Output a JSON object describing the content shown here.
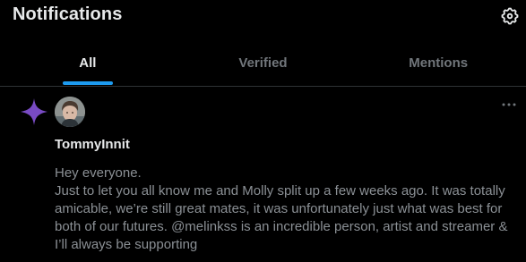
{
  "header": {
    "title": "Notifications",
    "settings_icon": "gear-icon"
  },
  "tabs": [
    {
      "label": "All",
      "active": true
    },
    {
      "label": "Verified",
      "active": false
    },
    {
      "label": "Mentions",
      "active": false
    }
  ],
  "notification": {
    "type_icon": "sparkle-icon",
    "author": "TommyInnit",
    "more_icon": "more-horizontal-icon",
    "text": "Hey everyone.\nJust to let you all know me and Molly split up a few weeks ago. It was totally amicable, we’re still great mates, it was unfortunately just what was best for both of our futures. @melinkss is an incredible person, artist and streamer & I’ll always be supporting"
  },
  "colors": {
    "background": "#000000",
    "text_primary": "#e7e9ea",
    "text_secondary": "#71767b",
    "accent": "#1d9bf0",
    "sparkle": "#794bc4",
    "divider": "#2f3336"
  }
}
